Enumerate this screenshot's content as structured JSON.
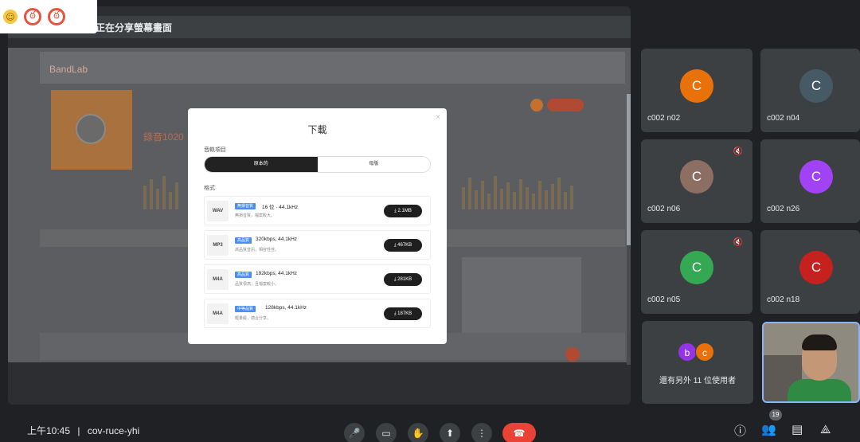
{
  "share": {
    "title": "正在分享螢幕畫面"
  },
  "reactions": {
    "emoji": "☺",
    "r1": "ఠ",
    "r2": "ఠ"
  },
  "bandlab": {
    "logo": "BandLab",
    "title": "錄音1020"
  },
  "modal": {
    "title": "下載",
    "close": "×",
    "section1": "音軌項目",
    "section2": "格式",
    "toggle": [
      "原本的",
      "母版"
    ],
    "formats": [
      {
        "code": "WAV",
        "badge": "無損音質",
        "spec": "16 位 · 44.1kHz",
        "desc": "無損音質，檔案較大。",
        "size": "2.1MB"
      },
      {
        "code": "MP3",
        "badge": "高品質",
        "spec": "320kbps, 44.1kHz",
        "desc": "高品質音訊，相容性佳。",
        "size": "467KB"
      },
      {
        "code": "M4A",
        "badge": "高品質",
        "spec": "192kbps, 44.1kHz",
        "desc": "品質很高，且檔案較小。",
        "size": "281KB"
      },
      {
        "code": "M4A",
        "badge": "中等品質",
        "spec": "128kbps, 44.1kHz",
        "desc": "輕量級，適合分享。",
        "size": "187KB"
      }
    ]
  },
  "participants": [
    {
      "name": "c002 n02",
      "initial": "C",
      "color": "#e8710a",
      "muted": false
    },
    {
      "name": "c002 n04",
      "initial": "C",
      "color": "#455a64",
      "muted": false
    },
    {
      "name": "c002 n06",
      "initial": "C",
      "color": "#8d6e63",
      "muted": true
    },
    {
      "name": "c002 n26",
      "initial": "C",
      "color": "#a142f4",
      "muted": false
    },
    {
      "name": "c002 n05",
      "initial": "C",
      "color": "#34a853",
      "muted": true
    },
    {
      "name": "c002 n18",
      "initial": "C",
      "color": "#c5221f",
      "muted": false
    }
  ],
  "more": {
    "text": "還有另外 11 位使用者",
    "a1": "b",
    "a1_color": "#9334e6",
    "a2": "c",
    "a2_color": "#e8710a"
  },
  "bottom": {
    "time": "上午10:45",
    "separator": "|",
    "meeting": "cov-ruce-yhi",
    "people_count": "19"
  },
  "icons": {
    "mic": "🎤",
    "camera": "▭",
    "hand": "✋",
    "present": "⬆",
    "more": "⋮",
    "hangup": "☎",
    "info": "ⓘ",
    "people": "👥",
    "chat": "▤",
    "activities": "⟁",
    "muted": "🔇"
  }
}
